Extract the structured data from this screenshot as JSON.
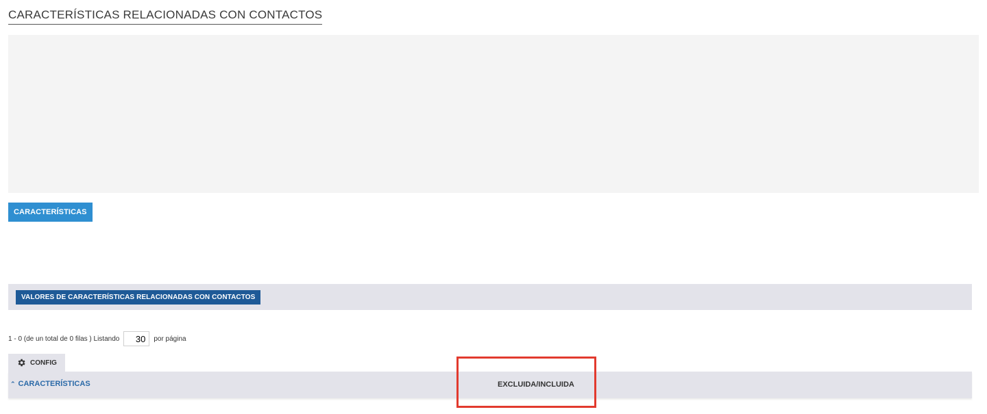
{
  "page": {
    "title": "CARACTERÍSTICAS RELACIONADAS CON CONTACTOS"
  },
  "actions": {
    "caracteristicas_button": "CARACTERÍSTICAS"
  },
  "section": {
    "values_button": "VALORES DE CARACTERÍSTICAS RELACIONADAS CON CONTACTOS"
  },
  "pager": {
    "summary": "1 - 0 (de un total de 0 filas ) Listando",
    "rows_per_page": "30",
    "suffix": "por página"
  },
  "toolbar": {
    "config_label": "CONFIG",
    "config_icon": "gear-icon"
  },
  "table": {
    "columns": [
      {
        "label": "CARACTERÍSTICAS",
        "sort": "ascending",
        "sort_icon": "caret-up-icon"
      },
      {
        "label": "EXCLUIDA/INCLUIDA"
      }
    ],
    "rows": []
  },
  "annotation": {
    "highlight_color": "#e23a2e"
  },
  "colors": {
    "primary_button": "#2f8fd1",
    "dark_button": "#1e5a97",
    "bar_background": "#e3e3ea",
    "panel_background": "#f4f4f4"
  }
}
